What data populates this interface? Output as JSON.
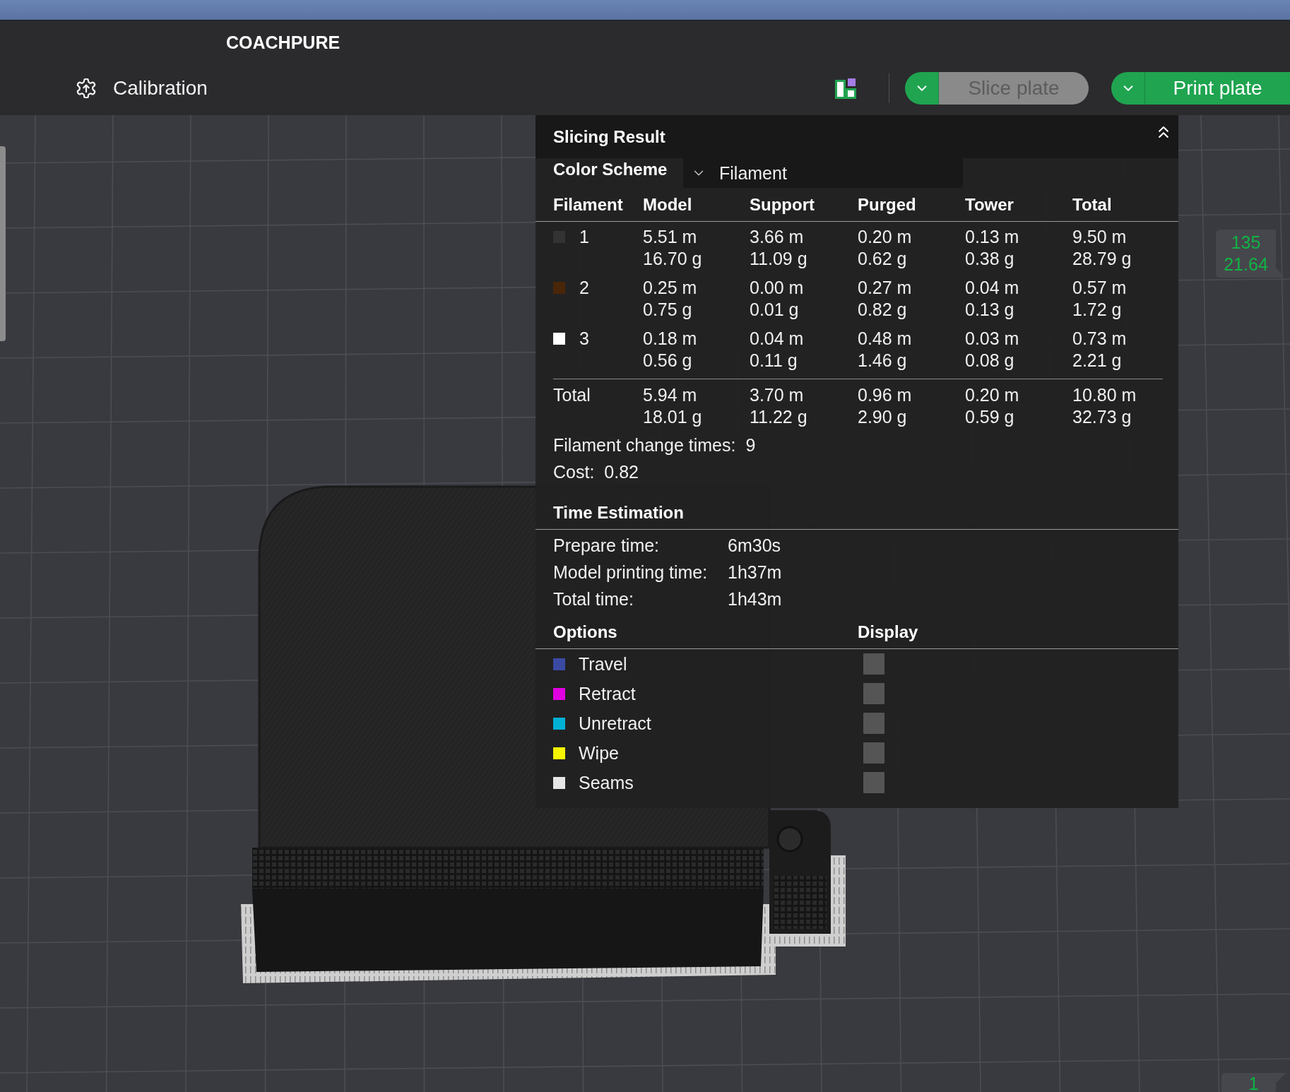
{
  "title_bar": {
    "title": "COACHPURE"
  },
  "toolbar": {
    "calibration": {
      "label": "Calibration"
    },
    "slice_button": {
      "label": "Slice plate",
      "disabled": true
    },
    "print_button": {
      "label": "Print plate",
      "disabled": false
    }
  },
  "slicing_result": {
    "title": "Slicing Result",
    "color_scheme": {
      "label": "Color Scheme",
      "value": "Filament"
    },
    "columns": [
      "Filament",
      "Model",
      "Support",
      "Purged",
      "Tower",
      "Total"
    ],
    "rows": [
      {
        "cells": [
          {
            "kind": "filament",
            "text": "1",
            "color": "#333333"
          },
          {
            "kind": "amount",
            "length": "5.51 m",
            "weight": "16.70 g"
          },
          {
            "kind": "amount",
            "length": "3.66 m",
            "weight": "11.09 g"
          },
          {
            "kind": "amount",
            "length": "0.20 m",
            "weight": "0.62 g"
          },
          {
            "kind": "amount",
            "length": "0.13 m",
            "weight": "0.38 g"
          },
          {
            "kind": "amount",
            "length": "9.50 m",
            "weight": "28.79 g"
          }
        ]
      },
      {
        "cells": [
          {
            "kind": "filament",
            "text": "2",
            "color": "#4a2608"
          },
          {
            "kind": "amount",
            "length": "0.25 m",
            "weight": "0.75 g"
          },
          {
            "kind": "amount",
            "length": "0.00 m",
            "weight": "0.01 g"
          },
          {
            "kind": "amount",
            "length": "0.27 m",
            "weight": "0.82 g"
          },
          {
            "kind": "amount",
            "length": "0.04 m",
            "weight": "0.13 g"
          },
          {
            "kind": "amount",
            "length": "0.57 m",
            "weight": "1.72 g"
          }
        ]
      },
      {
        "cells": [
          {
            "kind": "filament",
            "text": "3",
            "color": "#ffffff"
          },
          {
            "kind": "amount",
            "length": "0.18 m",
            "weight": "0.56 g"
          },
          {
            "kind": "amount",
            "length": "0.04 m",
            "weight": "0.11 g"
          },
          {
            "kind": "amount",
            "length": "0.48 m",
            "weight": "1.46 g"
          },
          {
            "kind": "amount",
            "length": "0.03 m",
            "weight": "0.08 g"
          },
          {
            "kind": "amount",
            "length": "0.73 m",
            "weight": "2.21 g"
          }
        ]
      }
    ],
    "total": {
      "cells": [
        {
          "kind": "label",
          "text": "Total"
        },
        {
          "kind": "amount",
          "length": "5.94 m",
          "weight": "18.01 g"
        },
        {
          "kind": "amount",
          "length": "3.70 m",
          "weight": "11.22 g"
        },
        {
          "kind": "amount",
          "length": "0.96 m",
          "weight": "2.90 g"
        },
        {
          "kind": "amount",
          "length": "0.20 m",
          "weight": "0.59 g"
        },
        {
          "kind": "amount",
          "length": "10.80 m",
          "weight": "32.73 g"
        }
      ]
    },
    "summary": [
      {
        "label": "Filament change times:",
        "value": "9"
      },
      {
        "label": "Cost:",
        "value": "0.82"
      }
    ]
  },
  "time_estimation": {
    "title": "Time Estimation",
    "items": [
      {
        "label": "Prepare time:",
        "value": "6m30s"
      },
      {
        "label": "Model printing time:",
        "value": "1h37m"
      },
      {
        "label": "Total time:",
        "value": "1h43m"
      }
    ]
  },
  "options": {
    "columns": [
      "Options",
      "Display"
    ],
    "items": [
      {
        "label": "Travel",
        "color": "#3a4aa3",
        "checked": false
      },
      {
        "label": "Retract",
        "color": "#e000e0",
        "checked": false
      },
      {
        "label": "Unretract",
        "color": "#00b0d5",
        "checked": false
      },
      {
        "label": "Wipe",
        "color": "#f5f500",
        "checked": false
      },
      {
        "label": "Seams",
        "color": "#e6e6e6",
        "checked": false
      }
    ]
  },
  "viewport": {
    "top_tooltip": {
      "lines": [
        "135",
        "21.64"
      ]
    },
    "bottom_tooltip": {
      "label": "1"
    }
  }
}
